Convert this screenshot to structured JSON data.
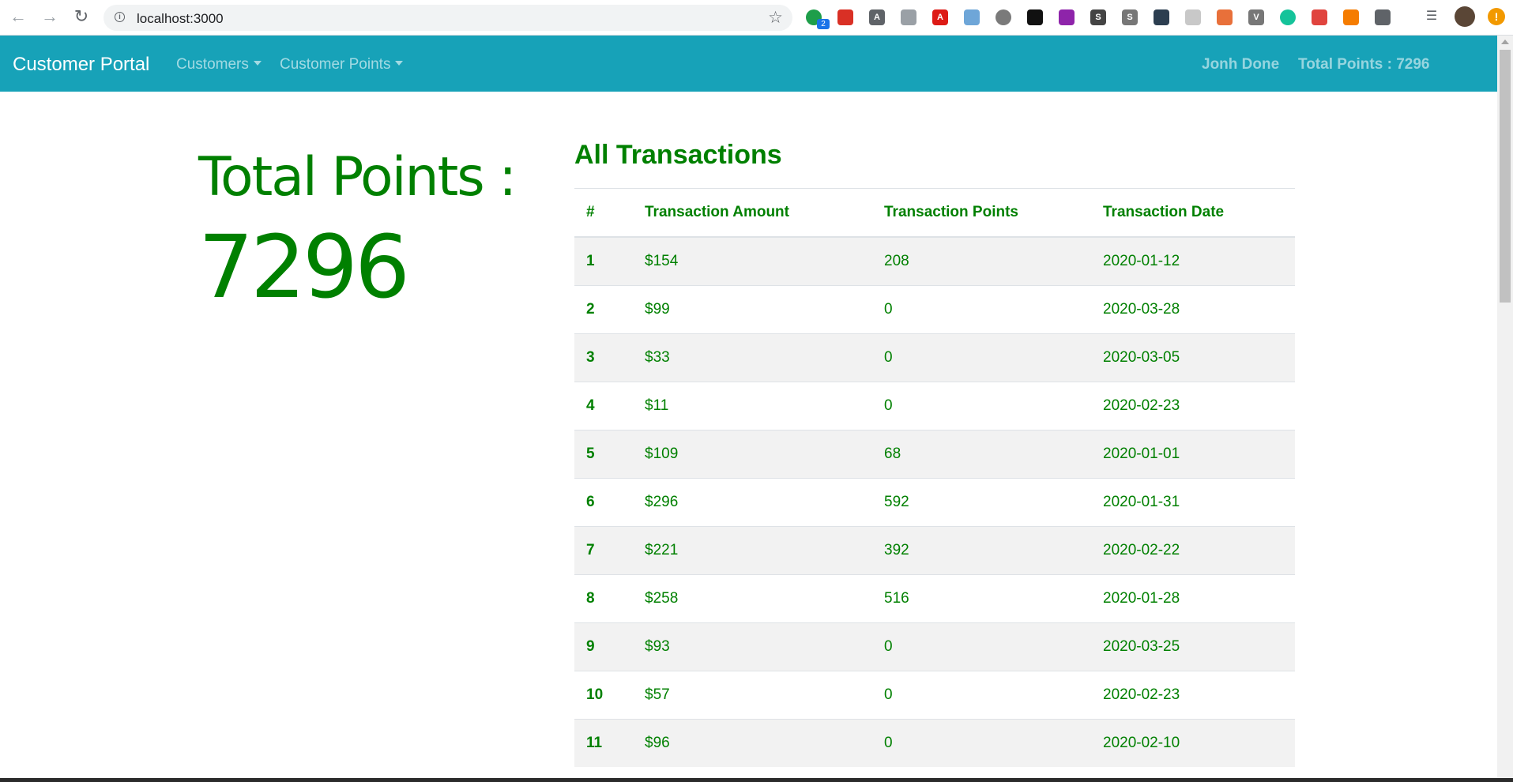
{
  "browser": {
    "url": "localhost:3000",
    "extension_badge": "2",
    "extensions": [
      {
        "icon": "green-dot-icon",
        "color": "#1e9e4a"
      },
      {
        "icon": "red-extension-icon",
        "color": "#d93025"
      },
      {
        "icon": "letter-a-icon",
        "color": "#5f6368",
        "glyph": "A"
      },
      {
        "icon": "cube-icon",
        "color": "#9aa0a6"
      },
      {
        "icon": "angular-icon",
        "color": "#dd1b16",
        "glyph": "A"
      },
      {
        "icon": "blue-swirl-icon",
        "color": "#6ea6d8"
      },
      {
        "icon": "gray-circle-icon",
        "color": "#7a7a7a"
      },
      {
        "icon": "black-v-icon",
        "color": "#111111"
      },
      {
        "icon": "purple-ext-icon",
        "color": "#8e24aa"
      },
      {
        "icon": "letter-s-icon",
        "color": "#444444",
        "glyph": "S"
      },
      {
        "icon": "letter-s-gray-icon",
        "color": "#777777",
        "glyph": "S"
      },
      {
        "icon": "dark-blue-ext-icon",
        "color": "#2c3e50"
      },
      {
        "icon": "pocket-icon",
        "color": "#c8c8c8"
      },
      {
        "icon": "glasses-icon",
        "color": "#e8703a"
      },
      {
        "icon": "v-icon",
        "color": "#777777",
        "glyph": "V"
      },
      {
        "icon": "grammarly-icon",
        "color": "#15c39a"
      },
      {
        "icon": "pdf-icon",
        "color": "#e0443e"
      },
      {
        "icon": "orange-gear-icon",
        "color": "#f57c00"
      },
      {
        "icon": "grid-icon",
        "color": "#5f6368"
      }
    ]
  },
  "navbar": {
    "brand": "Customer Portal",
    "menu": [
      "Customers",
      "Customer Points"
    ],
    "user_name": "Jonh Done",
    "total_points": "Total Points : 7296",
    "background": "#17a2b8"
  },
  "summary": {
    "label": "Total Points :",
    "value": "7296",
    "color": "#008000"
  },
  "transactions": {
    "title": "All Transactions",
    "columns": [
      "#",
      "Transaction Amount",
      "Transaction Points",
      "Transaction Date"
    ],
    "rows": [
      [
        "1",
        "$154",
        "208",
        "2020-01-12"
      ],
      [
        "2",
        "$99",
        "0",
        "2020-03-28"
      ],
      [
        "3",
        "$33",
        "0",
        "2020-03-05"
      ],
      [
        "4",
        "$11",
        "0",
        "2020-02-23"
      ],
      [
        "5",
        "$109",
        "68",
        "2020-01-01"
      ],
      [
        "6",
        "$296",
        "592",
        "2020-01-31"
      ],
      [
        "7",
        "$221",
        "392",
        "2020-02-22"
      ],
      [
        "8",
        "$258",
        "516",
        "2020-01-28"
      ],
      [
        "9",
        "$93",
        "0",
        "2020-03-25"
      ],
      [
        "10",
        "$57",
        "0",
        "2020-02-23"
      ],
      [
        "11",
        "$96",
        "0",
        "2020-02-10"
      ]
    ]
  }
}
